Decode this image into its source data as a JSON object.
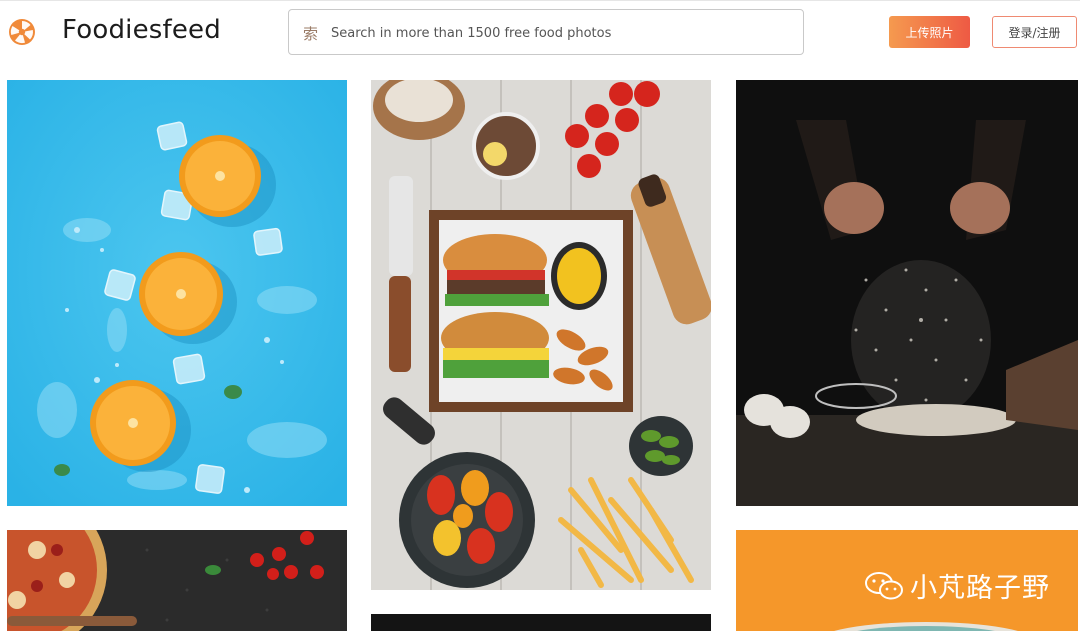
{
  "header": {
    "brand": "Foodiesfeed",
    "search": {
      "placeholder": "Search in more than 1500 free food photos",
      "icon": "search-icon"
    },
    "upload_label": "上传照片",
    "login_label": "登录/注册"
  },
  "colors": {
    "accent_start": "#f59a4f",
    "accent_end": "#ee5a44",
    "login_border": "#ef8a72"
  },
  "watermark": {
    "text": "小芃路子野",
    "icon": "wechat-icon"
  }
}
